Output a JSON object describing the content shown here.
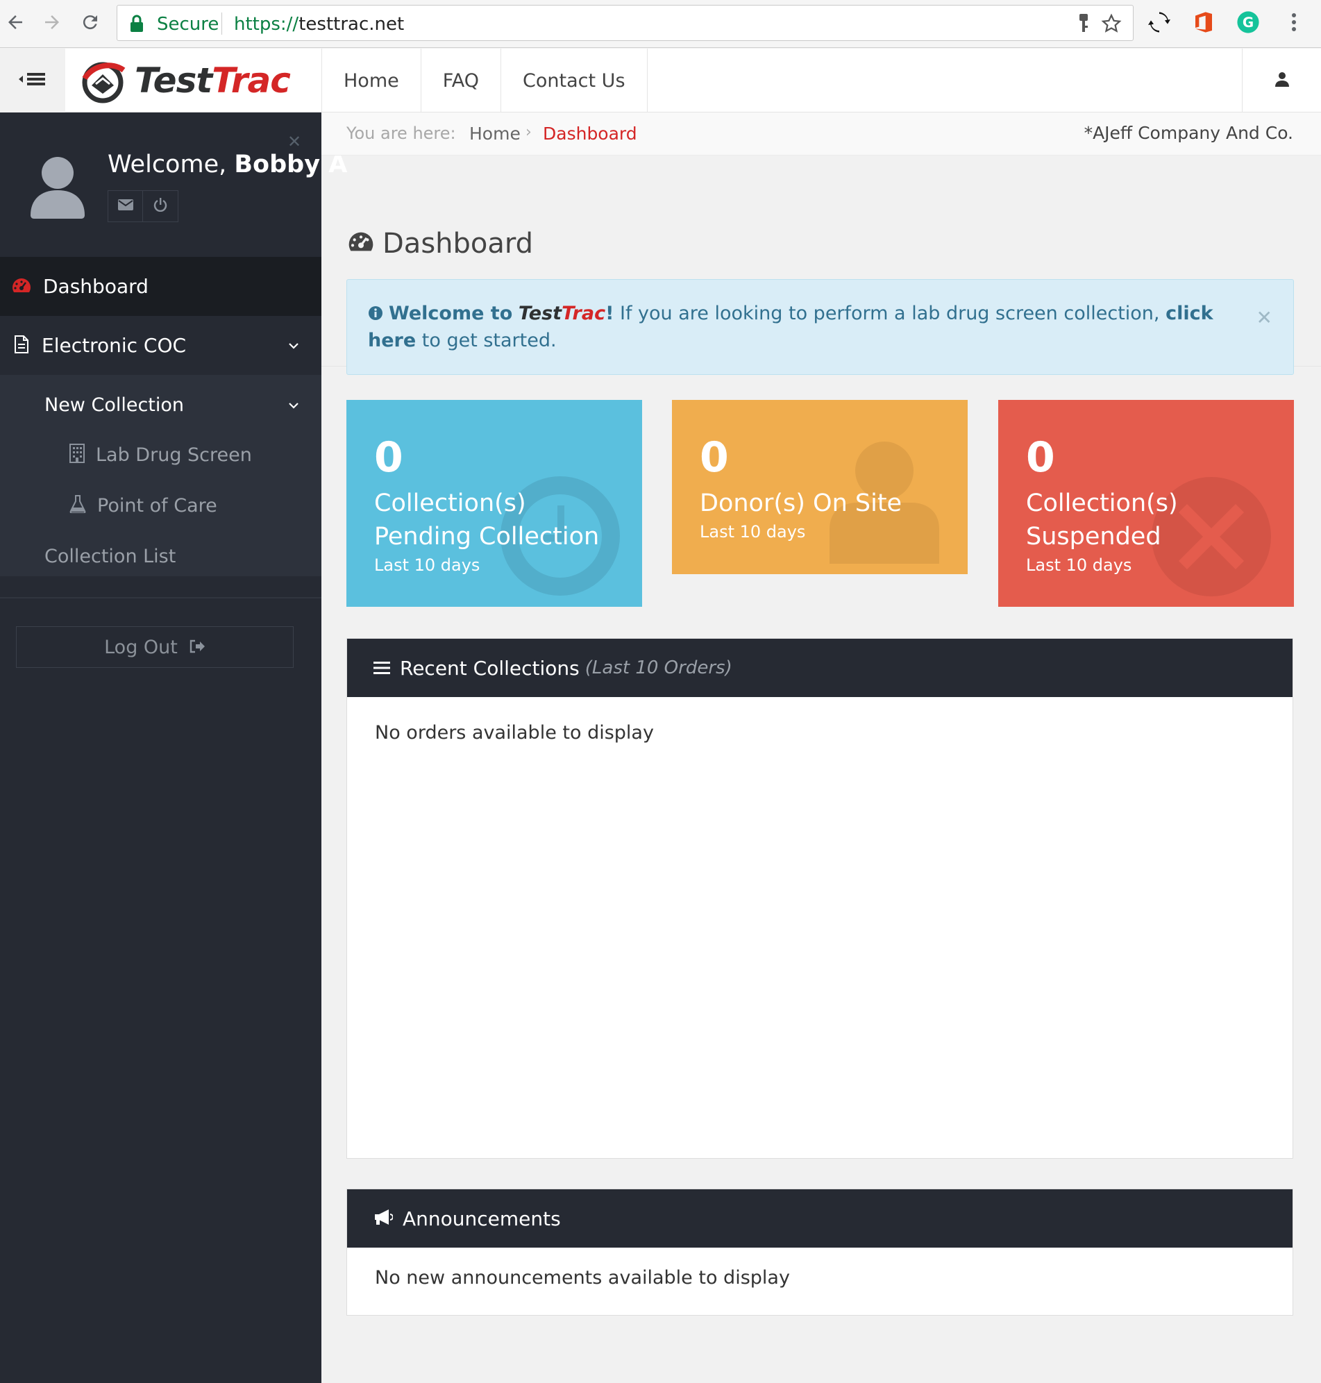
{
  "browser": {
    "secure_label": "Secure",
    "url_scheme": "https://",
    "url_host": "testtrac.net"
  },
  "app": {
    "logo_part1": "Test",
    "logo_part2": "Trac",
    "nav": [
      "Home",
      "FAQ",
      "Contact Us"
    ]
  },
  "sidebar": {
    "welcome_prefix": "Welcome,",
    "user_name": "Bobby A",
    "menu": {
      "dashboard": "Dashboard",
      "electronic_coc": "Electronic COC",
      "new_collection": "New Collection",
      "lab_drug_screen": "Lab Drug Screen",
      "point_of_care": "Point of Care",
      "collection_list": "Collection List"
    },
    "logout_label": "Log Out"
  },
  "breadcrumb": {
    "prefix": "You are here:",
    "home": "Home",
    "current": "Dashboard",
    "company": "*AJeff Company And Co."
  },
  "page": {
    "title": "Dashboard"
  },
  "alert": {
    "welcome": "Welcome to",
    "brand1": "Test",
    "brand2": "Trac",
    "bang": "!",
    "message": " If you are looking to perform a lab drug screen collection, ",
    "link": "click here",
    "suffix": " to get started."
  },
  "tiles": [
    {
      "value": "0",
      "label": "Collection(s) Pending Collection",
      "sub": "Last 10 days",
      "color": "#5bc0de"
    },
    {
      "value": "0",
      "label": "Donor(s) On Site",
      "sub": "Last 10 days",
      "color": "#f0ad4e"
    },
    {
      "value": "0",
      "label": "Collection(s) Suspended",
      "sub": "Last 10 days",
      "color": "#e45c4d"
    }
  ],
  "recent": {
    "title": "Recent Collections",
    "subtitle": "(Last 10 Orders)",
    "empty": "No orders available to display"
  },
  "announcements": {
    "title": "Announcements",
    "empty": "No new announcements available to display"
  },
  "colors": {
    "accent_red": "#d42626",
    "sidebar_bg": "#262a33",
    "info_bg": "#d9edf7"
  }
}
